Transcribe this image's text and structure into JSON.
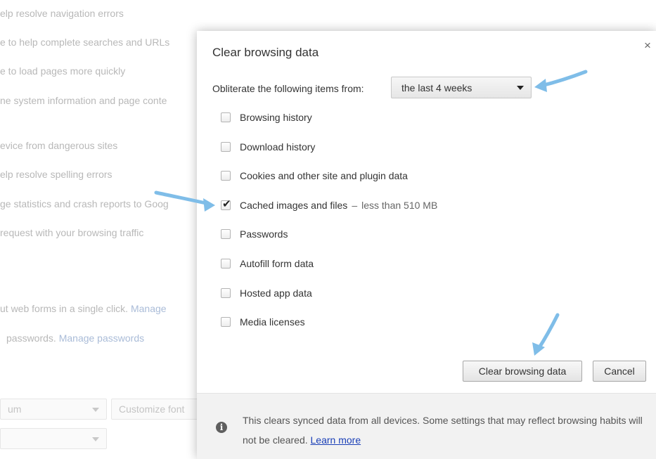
{
  "background": {
    "lines": [
      "elp resolve navigation errors",
      "e to help complete searches and URLs",
      "e to load pages more quickly",
      "ne system information and page conte",
      "evice from dangerous sites",
      "elp resolve spelling errors",
      "ge statistics and crash reports to Goog",
      "request with your browsing traffic"
    ],
    "autofill_text": "ut web forms in a single click.",
    "autofill_link": "Manage",
    "passwords_text": "passwords.",
    "passwords_link": "Manage passwords",
    "font_size_value": "um",
    "customize_fonts_label": "Customize font"
  },
  "dialog": {
    "title": "Clear browsing data",
    "close_glyph": "×",
    "range_label": "Obliterate the following items from:",
    "range_value": "the last 4 weeks",
    "options": [
      {
        "label": "Browsing history",
        "checked": false,
        "extra": ""
      },
      {
        "label": "Download history",
        "checked": false,
        "extra": ""
      },
      {
        "label": "Cookies and other site and plugin data",
        "checked": false,
        "extra": ""
      },
      {
        "label": "Cached images and files",
        "checked": true,
        "extra": "less than 510 MB"
      },
      {
        "label": "Passwords",
        "checked": false,
        "extra": ""
      },
      {
        "label": "Autofill form data",
        "checked": false,
        "extra": ""
      },
      {
        "label": "Hosted app data",
        "checked": false,
        "extra": ""
      },
      {
        "label": "Media licenses",
        "checked": false,
        "extra": ""
      }
    ],
    "separator": "–",
    "check_glyph": "✔",
    "clear_button": "Clear browsing data",
    "cancel_button": "Cancel",
    "footer_text": "This clears synced data from all devices. Some settings that may reflect browsing habits will not be cleared.",
    "footer_link": "Learn more",
    "info_glyph": "i"
  },
  "colors": {
    "annotation_arrow": "#7fbde8",
    "link": "#1a3fb7"
  }
}
